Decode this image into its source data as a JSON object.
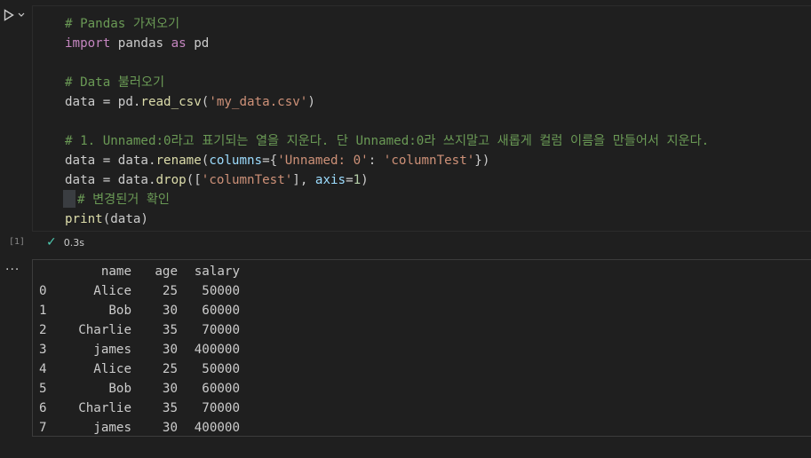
{
  "cell": {
    "code": {
      "l1_comment": "# Pandas 가져오기",
      "l2_import": "import",
      "l2_module": " pandas ",
      "l2_as": "as",
      "l2_alias": " pd",
      "l4_comment": "# Data 불러오기",
      "l5_var": "data",
      "l5_eq": " = pd.",
      "l5_fn": "read_csv",
      "l5_open": "(",
      "l5_arg": "'my_data.csv'",
      "l5_close": ")",
      "l7_comment": "# 1. Unnamed:0라고 표기되는 열을 지운다. 단 Unnamed:0라 쓰지말고 새롭게 컬럼 이름을 만들어서 지운다.",
      "l8_var": "data",
      "l8_eq": " = data.",
      "l8_fn": "rename",
      "l8_open": "(",
      "l8_kw": "columns",
      "l8_eq2": "={",
      "l8_key": "'Unnamed: 0'",
      "l8_colon": ": ",
      "l8_val": "'columnTest'",
      "l8_close": "})",
      "l9_var": "data",
      "l9_eq": " = data.",
      "l9_fn": "drop",
      "l9_open": "([",
      "l9_arg": "'columnTest'",
      "l9_mid": "], ",
      "l9_kw": "axis",
      "l9_eq2": "=",
      "l9_num": "1",
      "l9_close": ")",
      "l10_comment": "# 변경된거 확인",
      "l11_fn": "print",
      "l11_arg": "(data)"
    },
    "execution_count": "[1]",
    "duration": "0.3s",
    "status_icon": "check-icon"
  },
  "output": {
    "headers": [
      "",
      "name",
      "age",
      "salary"
    ],
    "rows": [
      [
        "0",
        "Alice",
        "25",
        "50000"
      ],
      [
        "1",
        "Bob",
        "30",
        "60000"
      ],
      [
        "2",
        "Charlie",
        "35",
        "70000"
      ],
      [
        "3",
        "james",
        "30",
        "400000"
      ],
      [
        "4",
        "Alice",
        "25",
        "50000"
      ],
      [
        "5",
        "Bob",
        "30",
        "60000"
      ],
      [
        "6",
        "Charlie",
        "35",
        "70000"
      ],
      [
        "7",
        "james",
        "30",
        "400000"
      ]
    ],
    "more_label": "..."
  },
  "colors": {
    "background": "#1f1f1f",
    "comment": "#6a9955",
    "keyword": "#c586c0",
    "function": "#dcdcaa",
    "string": "#ce9178",
    "number": "#b5cea8",
    "success": "#4ec9b0"
  }
}
